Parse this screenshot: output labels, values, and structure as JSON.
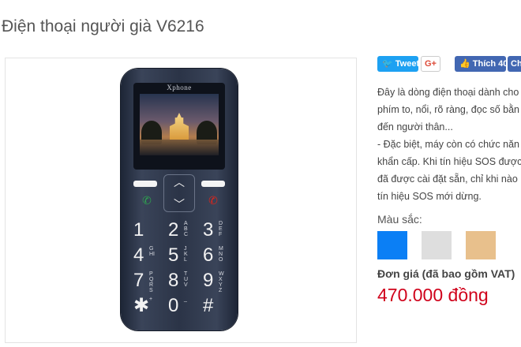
{
  "product": {
    "title": "Điện thoại người già V6216"
  },
  "phone_image": {
    "brand": "Xphone",
    "keys": [
      {
        "digit": "1",
        "sub": ""
      },
      {
        "digit": "2",
        "sub": "ABC"
      },
      {
        "digit": "3",
        "sub": "DEF"
      },
      {
        "digit": "4",
        "sub": "GHI"
      },
      {
        "digit": "5",
        "sub": "JKL"
      },
      {
        "digit": "6",
        "sub": "MNO"
      },
      {
        "digit": "7",
        "sub": "PQRS"
      },
      {
        "digit": "8",
        "sub": "TUV"
      },
      {
        "digit": "9",
        "sub": "WXYZ"
      },
      {
        "digit": "✱",
        "sub": "+"
      },
      {
        "digit": "0",
        "sub": "_"
      },
      {
        "digit": "#",
        "sub": ""
      }
    ]
  },
  "social": {
    "tweet": "Tweet",
    "gplus": "G+",
    "like": "Thích 40",
    "share": "Ch"
  },
  "description": {
    "lines": [
      "Đây là dòng điện thoại dành cho",
      "phím to, nổi, rõ ràng, đọc số bằn",
      "đến người thân...",
      "- Đặc biệt, máy còn có chức năn",
      "khẩn cấp. Khi tín hiệu SOS được",
      "đã được cài đặt sẵn, chỉ khi nào",
      "tín hiệu SOS mới dừng."
    ]
  },
  "colors": {
    "label": "Màu sắc:",
    "options": [
      "#0b7ff5",
      "#dedede",
      "#e8c08c"
    ]
  },
  "pricing": {
    "label": "Đơn giá (đã bao gồm VAT)",
    "value": "470.000 đồng"
  },
  "icons": [
    "twitter-icon",
    "facebook-thumb-icon",
    "dpad-up-icon",
    "dpad-down-icon",
    "call-icon",
    "end-call-icon"
  ]
}
